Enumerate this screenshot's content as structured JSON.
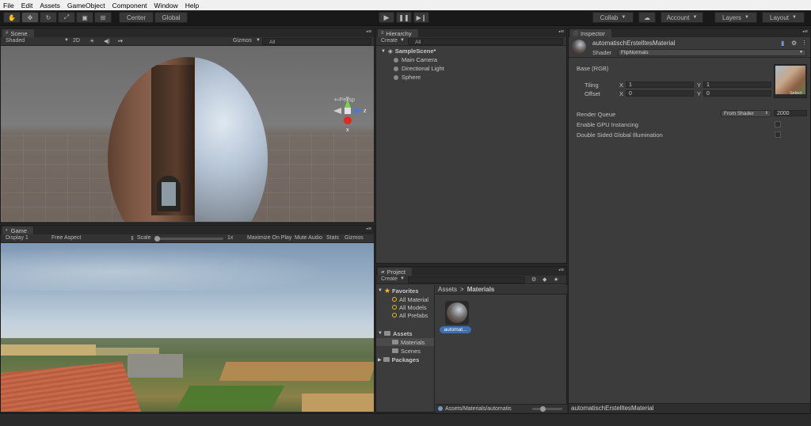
{
  "menu": [
    "File",
    "Edit",
    "Assets",
    "GameObject",
    "Component",
    "Window",
    "Help"
  ],
  "toolbar": {
    "pivot": "Center",
    "space": "Global",
    "collab": "Collab",
    "account": "Account",
    "layers": "Layers",
    "layout": "Layout"
  },
  "scene": {
    "tab": "Scene",
    "shading": "Shaded",
    "mode2d": "2D",
    "gizmos": "Gizmos",
    "search_placeholder": "All",
    "persp": "Persp",
    "axis_y": "y",
    "axis_z": "z",
    "axis_x": "x"
  },
  "game": {
    "tab": "Game",
    "display": "Display 1",
    "aspect": "Free Aspect",
    "scale_label": "Scale",
    "scale_value": "1x",
    "maximize": "Maximize On Play",
    "mute": "Mute Audio",
    "stats": "Stats",
    "gizmos": "Gizmos"
  },
  "hierarchy": {
    "tab": "Hierarchy",
    "create": "Create",
    "search_placeholder": "All",
    "scene_name": "SampleScene*",
    "items": [
      "Main Camera",
      "Directional Light",
      "Sphere"
    ]
  },
  "project": {
    "tab": "Project",
    "create": "Create",
    "favorites": "Favorites",
    "fav_items": [
      "All Material",
      "All Models",
      "All Prefabs"
    ],
    "assets": "Assets",
    "asset_folders": [
      "Materials",
      "Scenes"
    ],
    "packages": "Packages",
    "breadcrumb_root": "Assets",
    "breadcrumb_sep": ">",
    "breadcrumb_current": "Materials",
    "asset_item": "automat...",
    "path": "Assets/Materials/automatis"
  },
  "inspector": {
    "tab": "Inspector",
    "material_name": "automatischErstelltesMaterial",
    "shader_label": "Shader",
    "shader_value": "FlipNormals",
    "base_label": "Base (RGB)",
    "tiling_label": "Tiling",
    "offset_label": "Offset",
    "x_label": "X",
    "y_label": "Y",
    "tiling_x": "1",
    "tiling_y": "1",
    "offset_x": "0",
    "offset_y": "0",
    "select": "Select",
    "render_queue_label": "Render Queue",
    "render_queue_mode": "From Shader",
    "render_queue_value": "2000",
    "gpu_instancing": "Enable GPU Instancing",
    "double_sided": "Double Sided Global Illumination",
    "footer_name": "automatischErstelltesMaterial"
  },
  "icons": {
    "gear": "gear-icon",
    "lock": "lock-icon",
    "play": "play-icon",
    "pause": "pause-icon",
    "step": "step-icon"
  },
  "colors": {
    "selection": "#3d6eaf",
    "panel": "#3c3c3c",
    "toolbar": "#191919"
  }
}
